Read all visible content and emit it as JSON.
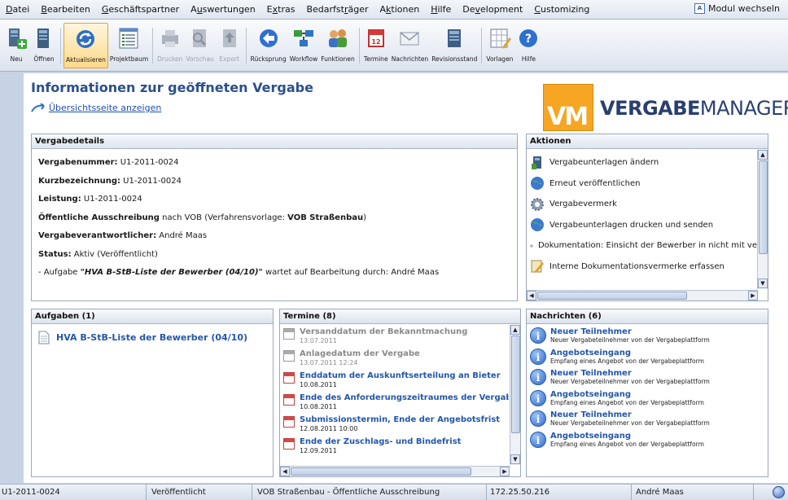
{
  "menu": {
    "items": [
      {
        "pre": "",
        "key": "D",
        "post": "atei"
      },
      {
        "pre": "",
        "key": "B",
        "post": "earbeiten"
      },
      {
        "pre": "",
        "key": "G",
        "post": "eschäftspartner"
      },
      {
        "pre": "A",
        "key": "u",
        "post": "swertungen"
      },
      {
        "pre": "E",
        "key": "x",
        "post": "tras"
      },
      {
        "pre": "Bedarfst",
        "key": "r",
        "post": "äger"
      },
      {
        "pre": "A",
        "key": "k",
        "post": "tionen"
      },
      {
        "pre": "",
        "key": "H",
        "post": "ilfe"
      },
      {
        "pre": "De",
        "key": "v",
        "post": "elopment"
      },
      {
        "pre": "",
        "key": "C",
        "post": "ustomizing"
      }
    ],
    "modul_label": "Modul wechseln"
  },
  "toolbar": {
    "buttons": [
      {
        "label": "Neu",
        "icon": "new-document-icon",
        "enabled": true,
        "active": false
      },
      {
        "label": "Öffnen",
        "icon": "open-icon",
        "enabled": true,
        "active": false
      },
      {
        "label": "Aktualisieren",
        "icon": "refresh-icon",
        "enabled": true,
        "active": true
      },
      {
        "label": "Projektbaum",
        "icon": "project-tree-icon",
        "enabled": true,
        "active": false
      },
      {
        "label": "Drucken",
        "icon": "print-icon",
        "enabled": false,
        "active": false
      },
      {
        "label": "Vorschau",
        "icon": "preview-icon",
        "enabled": false,
        "active": false
      },
      {
        "label": "Export",
        "icon": "export-icon",
        "enabled": false,
        "active": false
      },
      {
        "label": "Rücksprung",
        "icon": "back-icon",
        "enabled": true,
        "active": false
      },
      {
        "label": "Workflow",
        "icon": "workflow-icon",
        "enabled": true,
        "active": false
      },
      {
        "label": "Funktionen",
        "icon": "functions-icon",
        "enabled": true,
        "active": false
      },
      {
        "label": "Termine",
        "icon": "calendar-icon",
        "enabled": true,
        "active": false
      },
      {
        "label": "Nachrichten",
        "icon": "messages-icon",
        "enabled": true,
        "active": false
      },
      {
        "label": "Revisionsstand",
        "icon": "revision-icon",
        "enabled": true,
        "active": false
      },
      {
        "label": "Vorlagen",
        "icon": "templates-icon",
        "enabled": true,
        "active": false
      },
      {
        "label": "Hilfe",
        "icon": "help-icon",
        "enabled": true,
        "active": false
      }
    ]
  },
  "header": {
    "title": "Informationen zur geöffneten Vergabe",
    "overview_link": "Übersichtsseite anzeigen",
    "logo_vm": "VM",
    "logo_brand_bold": "VERGABE",
    "logo_brand_light": "MANAGER"
  },
  "details": {
    "title": "Vergabedetails",
    "vergabenummer_label": "Vergabenummer:",
    "vergabenummer": "U1-2011-0024",
    "kurzbezeichnung_label": "Kurzbezeichnung:",
    "kurzbezeichnung": "U1-2011-0024",
    "leistung_label": "Leistung:",
    "leistung": "U1-2011-0024",
    "ausschreibung_label": "Öffentliche Ausschreibung",
    "ausschreibung_text": "nach VOB (Verfahrensvorlage:",
    "verfahrensvorlage": "VOB Straßenbau",
    "ausschreibung_close": ")",
    "verantwortlich_label": "Vergabeverantwortlicher:",
    "verantwortlich": "André Maas",
    "status_label": "Status:",
    "status": "Aktiv (Veröffentlicht)",
    "task_prefix": "- Aufgabe",
    "task_name": "\"HVA B-StB-Liste der Bewerber (04/10)\"",
    "task_suffix": "wartet auf Bearbeitung durch: André Maas"
  },
  "aktionen": {
    "title": "Aktionen",
    "items": [
      {
        "label": "Vergabeunterlagen ändern",
        "icon": "edit-documents-icon"
      },
      {
        "label": "Erneut veröffentlichen",
        "icon": "globe-icon"
      },
      {
        "label": "Vergabevermerk",
        "icon": "gear-icon"
      },
      {
        "label": "Vergabeunterlagen drucken und senden",
        "icon": "globe-icon"
      },
      {
        "label": "Dokumentation: Einsicht der Bewerber in nicht mit ve",
        "icon": "gear-icon"
      },
      {
        "label": "Interne Dokumentationsvermerke erfassen",
        "icon": "pencil-icon"
      }
    ]
  },
  "aufgaben": {
    "title": "Aufgaben (1)",
    "items": [
      {
        "label": "HVA B-StB-Liste der Bewerber (04/10)"
      }
    ]
  },
  "termine": {
    "title": "Termine (8)",
    "items": [
      {
        "title": "Versanddatum der Bekanntmachung",
        "date": "13.07.2011",
        "past": true
      },
      {
        "title": "Anlagedatum der Vergabe",
        "date": "13.07.2011 12:24",
        "past": true
      },
      {
        "title": "Enddatum der Auskunftserteilung an Bieter",
        "date": "10.08.2011",
        "past": false
      },
      {
        "title": "Ende des Anforderungszeitraumes der Vergab",
        "date": "10.08.2011",
        "past": false
      },
      {
        "title": "Submissionstermin, Ende der Angebotsfrist",
        "date": "12.08.2011 10:00",
        "past": false
      },
      {
        "title": "Ende der Zuschlags- und Bindefrist",
        "date": "12.09.2011",
        "past": false
      }
    ]
  },
  "nachrichten": {
    "title": "Nachrichten (6)",
    "items": [
      {
        "title": "Neuer Teilnehmer",
        "text": "Neuer Vergabeteilnehmer von der Vergabeplattform"
      },
      {
        "title": "Angebotseingang",
        "text": "Empfang eines Angebot von der Vergabeplattform"
      },
      {
        "title": "Neuer Teilnehmer",
        "text": "Neuer Vergabeteilnehmer von der Vergabeplattform"
      },
      {
        "title": "Angebotseingang",
        "text": "Empfang eines Angebot von der Vergabeplattform"
      },
      {
        "title": "Neuer Teilnehmer",
        "text": "Neuer Vergabeteilnehmer von der Vergabeplattform"
      },
      {
        "title": "Angebotseingang",
        "text": "Empfang eines Angebot von der Vergabeplattform"
      }
    ]
  },
  "statusbar": {
    "cells": [
      {
        "text": "U1-2011-0024"
      },
      {
        "text": "Veröffentlicht"
      },
      {
        "text": "VOB Straßenbau - Öffentliche Ausschreibung"
      },
      {
        "text": "172.25.50.216"
      },
      {
        "text": "André Maas"
      }
    ]
  },
  "colors": {
    "accent": "#2457a8",
    "title": "#2a4f8e",
    "logo_orange": "#f6a623"
  }
}
